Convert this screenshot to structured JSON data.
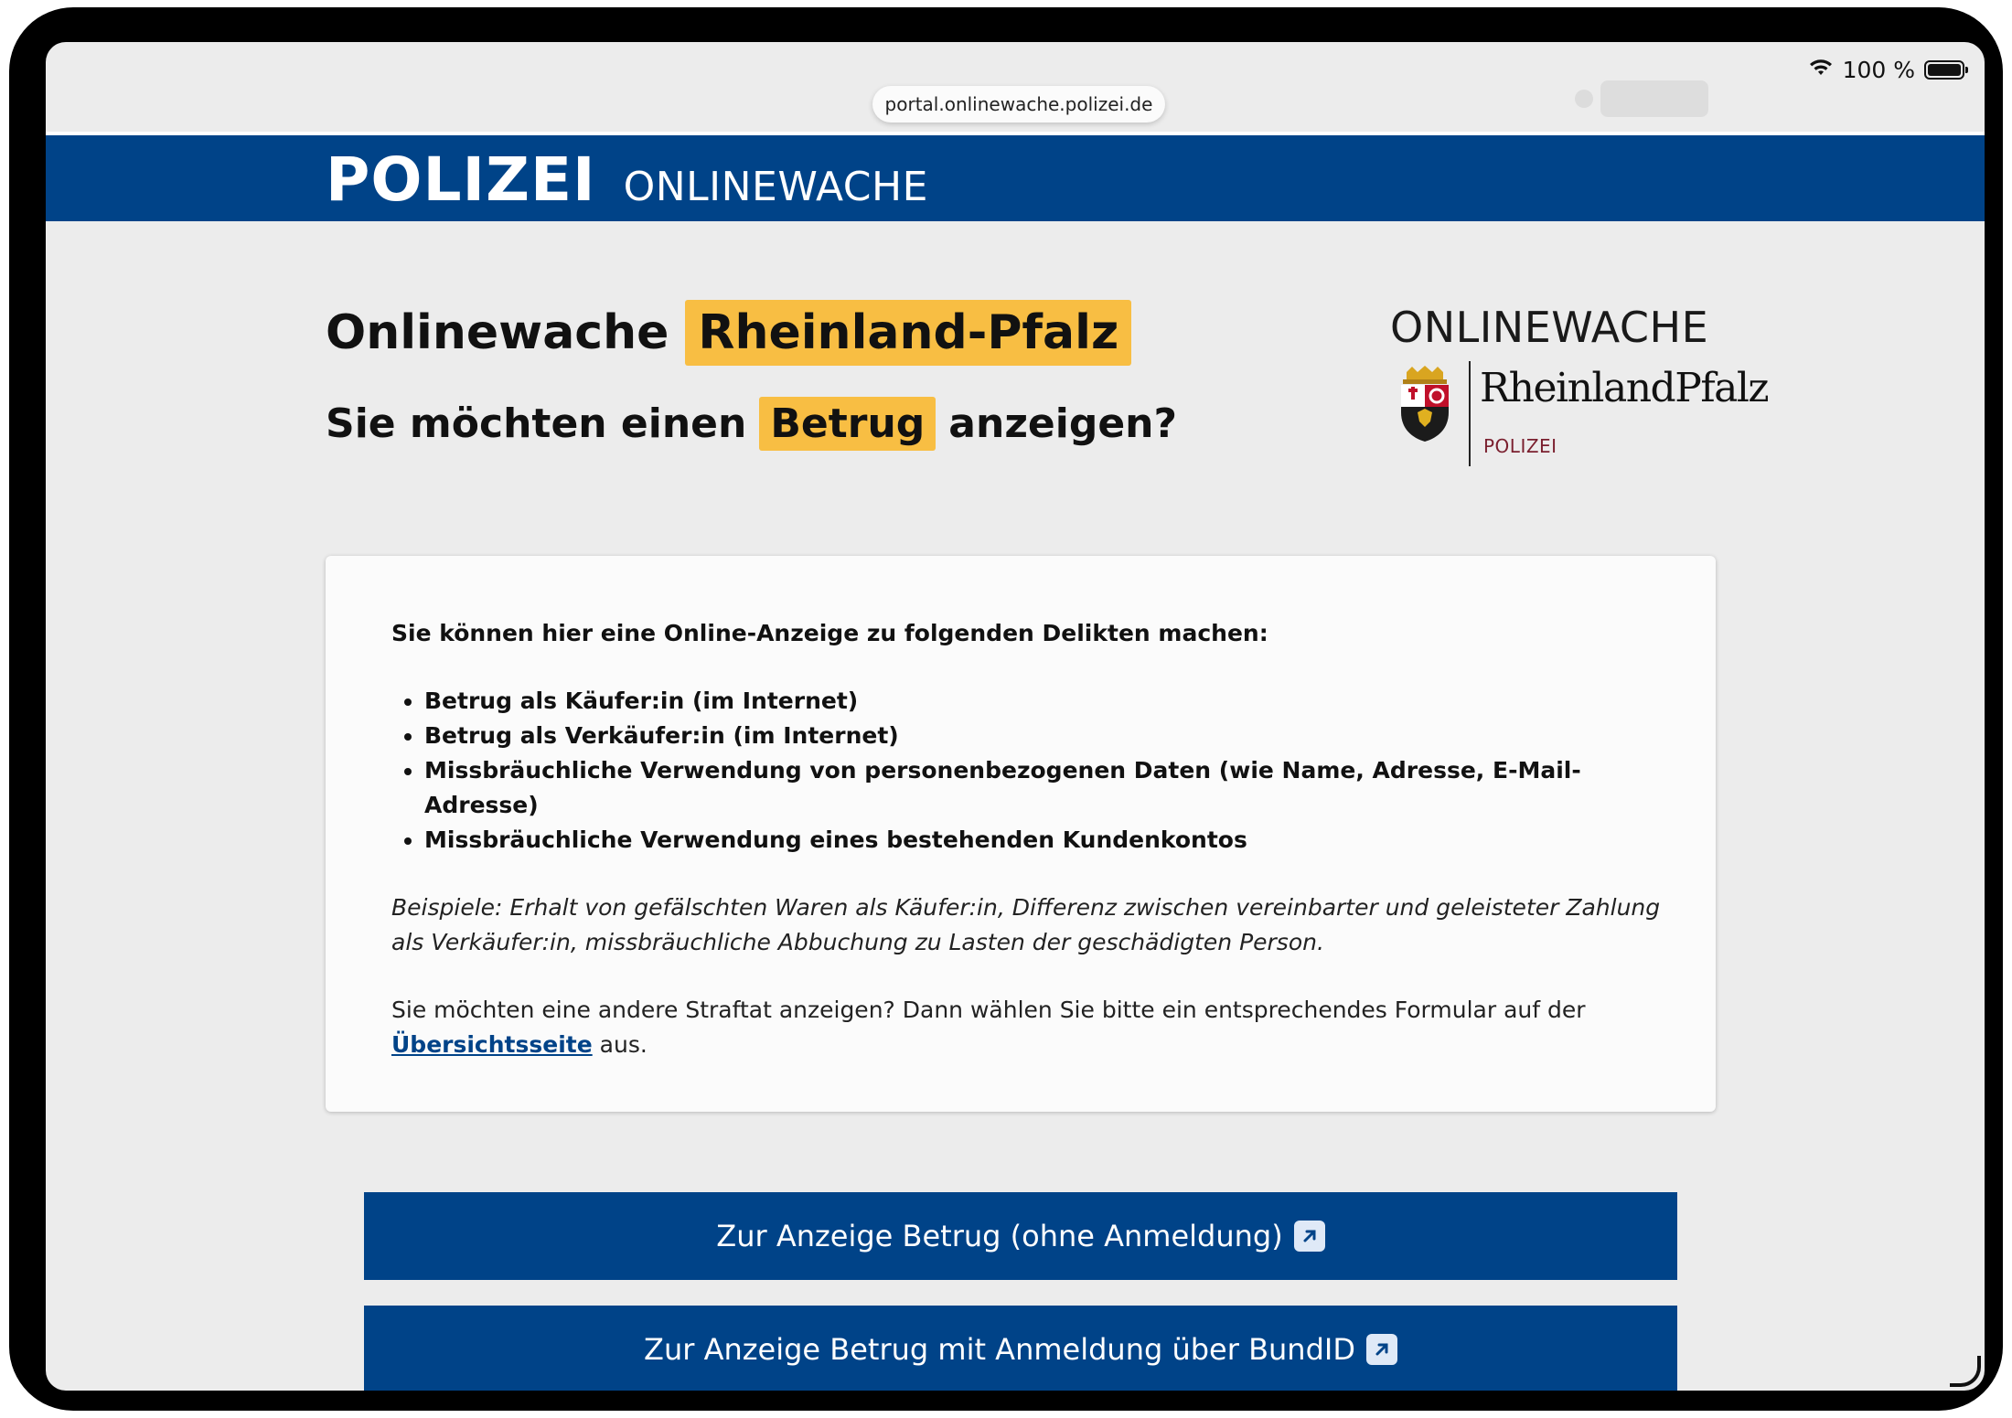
{
  "status_bar": {
    "battery_percent": "100 %"
  },
  "browser": {
    "url": "portal.onlinewache.polizei.de"
  },
  "header": {
    "brand_bold": "POLIZEI",
    "brand_light": "ONLINEWACHE"
  },
  "page": {
    "title_prefix": "Onlinewache",
    "title_highlight": "Rheinland-Pfalz",
    "question_prefix": "Sie möchten einen",
    "question_highlight": "Betrug",
    "question_suffix": "anzeigen?"
  },
  "logo": {
    "title": "ONLINEWACHE",
    "state_name": "RheinlandPfalz",
    "subtitle": "POLIZEI"
  },
  "card": {
    "intro": "Sie können hier eine Online-Anzeige zu folgenden Delikten machen:",
    "items": [
      "Betrug als Käufer:in (im Internet)",
      "Betrug als Verkäufer:in (im Internet)",
      "Missbräuchliche Verwendung von personenbezogenen Daten (wie Name, Adresse, E-Mail-Adresse)",
      "Missbräuchliche Verwendung eines bestehenden Kundenkontos"
    ],
    "examples": "Beispiele: Erhalt von gefälschten Waren als Käufer:in, Differenz zwischen vereinbarter und geleisteter Zahlung als Verkäufer:in, missbräuchliche Abbuchung zu Lasten der geschädigten Person.",
    "other_prefix": "Sie möchten eine andere Straftat anzeigen? Dann wählen Sie bitte ein entsprechendes Formular auf der",
    "other_link": "Übersichtsseite",
    "other_suffix": " aus."
  },
  "buttons": {
    "report_without_login": "Zur Anzeige Betrug (ohne Anmeldung)",
    "report_with_bundid": "Zur Anzeige Betrug mit Anmeldung über BundID"
  },
  "icons": {
    "wifi": "wifi-icon",
    "battery": "battery-icon",
    "external_link": "external-link-icon",
    "crest": "coat-of-arms-icon"
  },
  "colors": {
    "brand_blue": "#004388",
    "highlight_yellow": "#f8be43",
    "page_bg": "#ececec"
  }
}
